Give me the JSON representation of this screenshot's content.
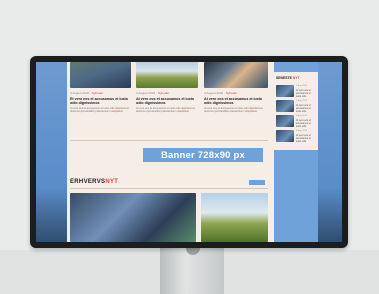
{
  "banner": {
    "text": "Banner 728x90 px"
  },
  "articles_top": [
    {
      "date": "4 August 2020",
      "category": "Nyheder",
      "title": "Et vero eos et accusamus et iusto odio dignissimos",
      "body": "At vero eos et accusamus et iusto odio dignissimos ducimus qui blanditiis praesentium",
      "tag": "voluptatum"
    },
    {
      "date": "4 August 2020",
      "category": "Nyheder",
      "title": "At vero eos et accusamus et iusto odio dignissimos",
      "body": "At vero eos et accusamus et iusto odio dignissimos ducimus qui blanditiis praesentium",
      "tag": "voluptatum"
    },
    {
      "date": "4 August 2020",
      "category": "Nyheder",
      "title": "At vero eos et accusamus et iusto odio dignissimos",
      "body": "At vero eos et accusamus et iusto odio dignissimos ducimus qui blanditiis praesentium",
      "tag": "voluptatum"
    }
  ],
  "section": {
    "title_main": "ERHVERVS",
    "title_accent": "NYT"
  },
  "sidebar": {
    "heading_main": "SENESTE ",
    "heading_accent": "NYT",
    "items": [
      {
        "date": "4 Aug 2020",
        "text": "At vero eos et accusamus et iusto odio"
      },
      {
        "date": "4 Aug 2020",
        "text": "At vero eos et accusamus et iusto odio"
      },
      {
        "date": "4 Aug 2020",
        "text": "At vero eos et accusamus et iusto odio"
      },
      {
        "date": "4 Aug 2020",
        "text": "At vero eos et accusamus et iusto odio"
      }
    ]
  },
  "colors": {
    "accent": "#c94d3f",
    "brand_blue": "#6ea2d8",
    "page_bg": "#f5ede6"
  }
}
